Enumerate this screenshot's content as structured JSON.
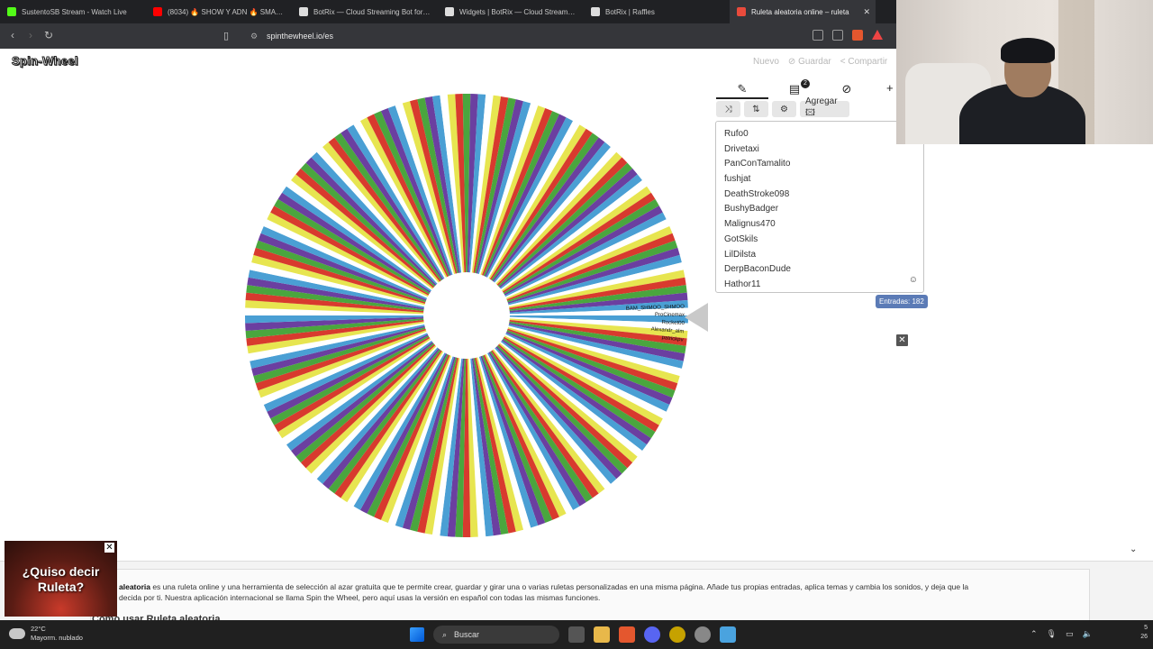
{
  "browser": {
    "tabs": [
      {
        "label": "SustentoSB Stream - Watch Live",
        "icon_color": "#53fc18"
      },
      {
        "label": "(8034) 🔥 SHOW Y ADN 🔥 SMASH",
        "icon_color": "#ff0000"
      },
      {
        "label": "BotRix — Cloud Streaming Bot for Tw",
        "icon_color": "#dddddd"
      },
      {
        "label": "Widgets | BotRix — Cloud Streaming",
        "icon_color": "#dddddd"
      },
      {
        "label": "BotRix | Raffles",
        "icon_color": "#dddddd"
      },
      {
        "label": "Ruleta aleatoria online – ruleta",
        "icon_color": "#e94b3c",
        "active": true
      }
    ],
    "url": "spinthewheel.io/es"
  },
  "page": {
    "logo": "Spin-Wheel",
    "top_buttons": [
      "Nuevo",
      "⊘ Guardar",
      "< Compartir"
    ],
    "panel": {
      "tab_badge": "2",
      "tools": {
        "add_label": "Agregar 🖾"
      },
      "entries": [
        "Rufo0",
        "Drivetaxi",
        "PanConTamalito",
        "fushjat",
        "DeathStroke098",
        "BushyBadger",
        "Malignus470",
        "GotSkils",
        "LilDilsta",
        "DerpBaconDude",
        "Hathor11"
      ],
      "count_label": "Entradas: 182"
    },
    "wheel": {
      "segment_count": 182,
      "colors": [
        "#4a9fd4",
        "#ffffff",
        "#e7e550",
        "#d83a2e",
        "#4aa63e",
        "#6b3fa0"
      ],
      "visible_labels": [
        "BAM_SHMOO_SHMOO",
        "ProCinemax",
        "Rocket00",
        "Alexandr_alm",
        "patrickpv"
      ]
    },
    "description": {
      "lead_bold": "aleatoria",
      "text": " es una ruleta online y una herramienta de selección al azar gratuita que te permite crear, guardar y girar una o varias ruletas personalizadas en una misma página. Añade tus propias entradas, aplica temas y cambia los sonidos, y deja que la",
      "text2": "decida por ti. Nuestra aplicación internacional se llama Spin the Wheel, pero aquí usas la versión en español con todas las mismas funciones.",
      "subheading": "Cómo usar Ruleta aleatoria"
    },
    "promo": {
      "text": "¿Quiso decir Ruleta?"
    }
  },
  "taskbar": {
    "weather": {
      "temp": "22°C",
      "desc": "Mayorm. nublado"
    },
    "search": "Buscar",
    "clock": {
      "time": "5",
      "date": "26"
    }
  }
}
